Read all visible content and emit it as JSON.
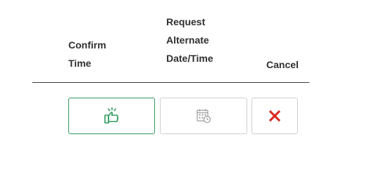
{
  "headers": {
    "confirm": {
      "line1": "Confirm",
      "line2": "Time"
    },
    "request": {
      "line1": "Request",
      "line2": "Alternate",
      "line3": "Date/Time"
    },
    "cancel": {
      "line1": "Cancel"
    }
  },
  "buttons": {
    "confirm": {
      "icon": "thumbs-up-icon",
      "color": "#2e9a5e",
      "state": "enabled"
    },
    "request": {
      "icon": "calendar-clock-icon",
      "color": "#9a9a9a",
      "state": "disabled"
    },
    "cancel": {
      "icon": "close-x-icon",
      "color": "#d9251c",
      "state": "enabled"
    }
  }
}
